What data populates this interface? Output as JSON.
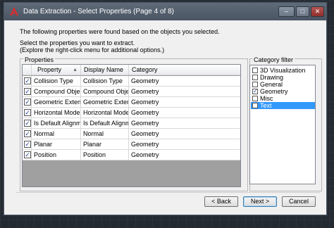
{
  "window": {
    "title": "Data Extraction - Select Properties (Page 4 of 8)",
    "controls": {
      "minimize": "–",
      "maximize": "□",
      "close": "✕"
    }
  },
  "intro": {
    "line1": "The following properties were found based on the objects you selected.",
    "line2": "Select the properties you want to extract.",
    "line3": "(Explore the right-click menu for additional options.)"
  },
  "properties": {
    "group_label": "Properties",
    "columns": [
      "Property",
      "Display Name",
      "Category"
    ],
    "sort_indicator": "▲",
    "rows": [
      {
        "checked": true,
        "property": "Collision Type",
        "display_name": "Collision Type",
        "category": "Geometry"
      },
      {
        "checked": true,
        "property": "Compound Objec...",
        "display_name": "Compound Objec...",
        "category": "Geometry"
      },
      {
        "checked": true,
        "property": "Geometric Extents",
        "display_name": "Geometric Extents",
        "category": "Geometry"
      },
      {
        "checked": true,
        "property": "Horizontal Mode",
        "display_name": "Horizontal Mode",
        "category": "Geometry"
      },
      {
        "checked": true,
        "property": "Is Default Alignm...",
        "display_name": "Is Default Alignm...",
        "category": "Geometry"
      },
      {
        "checked": true,
        "property": "Normal",
        "display_name": "Normal",
        "category": "Geometry"
      },
      {
        "checked": true,
        "property": "Planar",
        "display_name": "Planar",
        "category": "Geometry"
      },
      {
        "checked": true,
        "property": "Position",
        "display_name": "Position",
        "category": "Geometry"
      }
    ]
  },
  "category_filter": {
    "group_label": "Category filter",
    "items": [
      {
        "label": "3D Visualization",
        "checked": false,
        "selected": false
      },
      {
        "label": "Drawing",
        "checked": false,
        "selected": false
      },
      {
        "label": "General",
        "checked": false,
        "selected": false
      },
      {
        "label": "Geometry",
        "checked": true,
        "selected": false
      },
      {
        "label": "Misc",
        "checked": false,
        "selected": false
      },
      {
        "label": "Text",
        "checked": false,
        "selected": true
      }
    ]
  },
  "buttons": {
    "back": "< Back",
    "next": "Next >",
    "cancel": "Cancel"
  },
  "colors": {
    "titlebar": "#4a5563",
    "selection": "#3399ff",
    "grid_empty": "#a0a0a0",
    "app_icon": "#d32f2f"
  },
  "icons": {
    "app": "autocad-logo-icon",
    "check": "checkmark-icon"
  }
}
